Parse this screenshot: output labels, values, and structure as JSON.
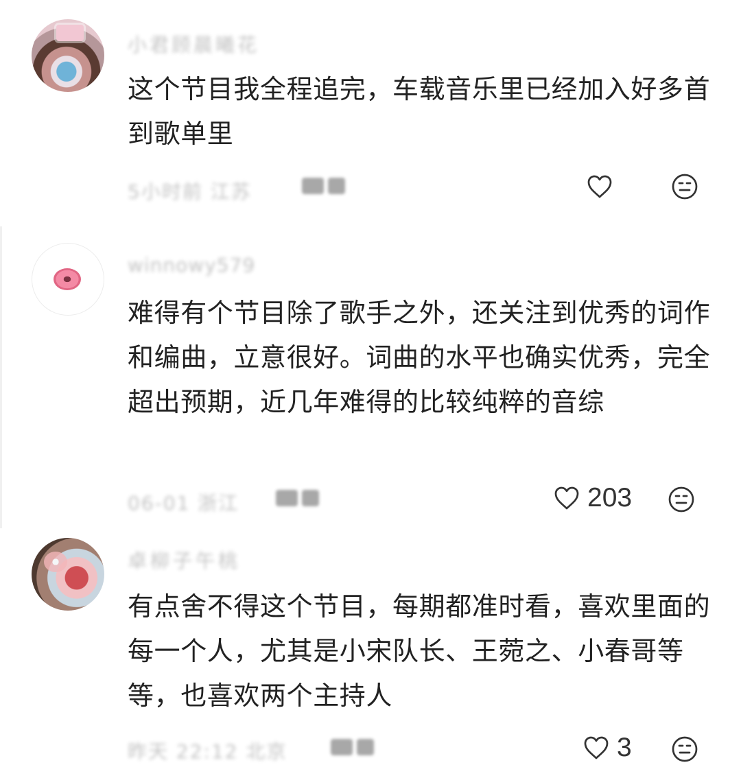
{
  "comments": [
    {
      "username": "小君顾晨曦花",
      "text": "这个节目我全程追完，车载音乐里已经加入好多首到歌单里",
      "meta": "5小时前 江苏",
      "reply_label": "回复",
      "likes": "",
      "like_icon": "heart-outline-icon",
      "dislike_icon": "expressionless-face-icon"
    },
    {
      "username": "winnowy579",
      "text": "难得有个节目除了歌手之外，还关注到优秀的词作和编曲，立意很好。词曲的水平也确实优秀，完全超出预期，近几年难得的比较纯粹的音综",
      "meta": "06-01 浙江",
      "reply_label": "回复",
      "likes": "203",
      "like_icon": "heart-outline-icon",
      "dislike_icon": "expressionless-face-icon"
    },
    {
      "username": "卓柳子午桃",
      "text": "有点舍不得这个节目，每期都准时看，喜欢里面的每一个人，尤其是小宋队长、王菀之、小春哥等等，也喜欢两个主持人",
      "meta": "昨天 22:12 北京",
      "reply_label": "回复",
      "likes": "3",
      "like_icon": "heart-outline-icon",
      "dislike_icon": "expressionless-face-icon"
    }
  ],
  "colors": {
    "text": "#222222",
    "muted": "#6f6f6f",
    "icon": "#333333",
    "background": "#ffffff"
  }
}
